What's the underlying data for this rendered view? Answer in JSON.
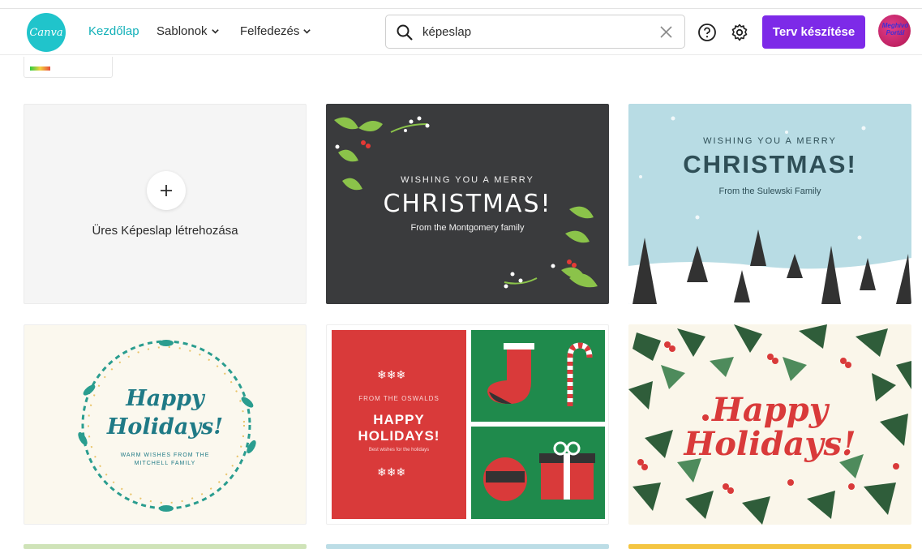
{
  "header": {
    "logo_text": "Canva",
    "nav": [
      {
        "label": "Kezdőlap",
        "active": true
      },
      {
        "label": "Sablonok",
        "active": false
      },
      {
        "label": "Felfedezés",
        "active": false
      }
    ],
    "search": {
      "value": "képeslap",
      "placeholder": ""
    },
    "create_button": "Terv készítése",
    "avatar_text": "Meghívó Portál",
    "accent": "#7d2ae8",
    "brand": "#20c4cb"
  },
  "grid": {
    "blank_card_label": "Üres Képeslap létrehozása",
    "templates": [
      {
        "line1": "WISHING YOU A MERRY",
        "title": "CHRISTMAS!",
        "line3": "From the Montgomery family"
      },
      {
        "line1": "WISHING YOU A MERRY",
        "title": "CHRISTMAS!",
        "line3": "From the Sulewski Family"
      },
      {
        "title1": "Happy",
        "title2": "Holidays!",
        "line3": "WARM WISHES FROM THE",
        "line4": "MITCHELL FAMILY"
      },
      {
        "line1": "FROM THE OSWALDS",
        "title1": "HAPPY",
        "title2": "HOLIDAYS!",
        "line3": "Best wishes for the holidays"
      },
      {
        "title1": "Happy",
        "title2": "Holidays!"
      }
    ]
  },
  "icons": [
    "search-icon",
    "clear-icon",
    "help-icon",
    "gear-icon",
    "plus-icon",
    "chevron-down-icon"
  ]
}
